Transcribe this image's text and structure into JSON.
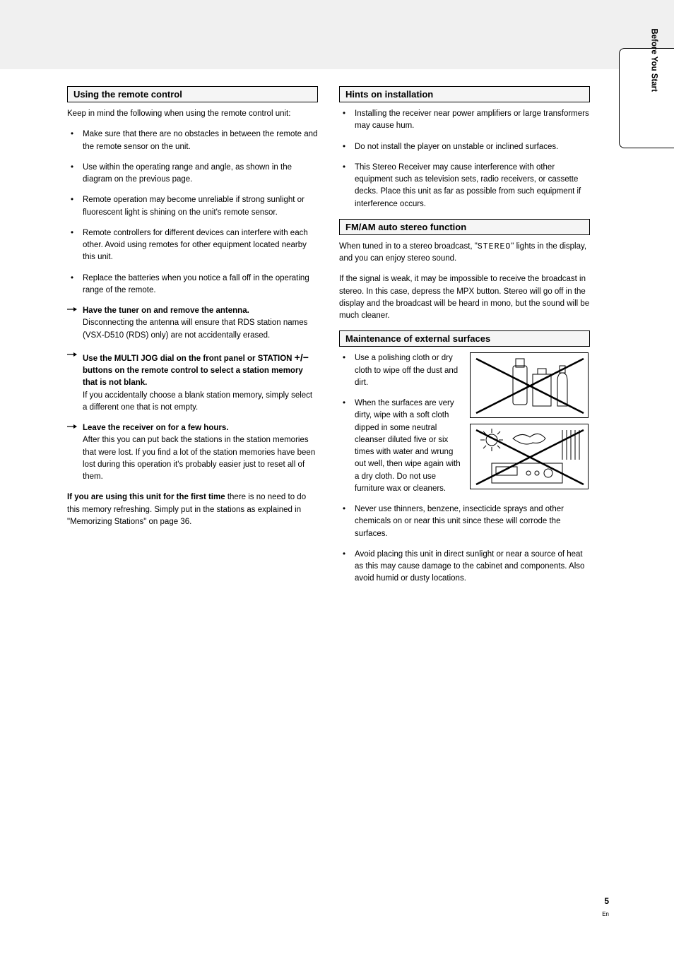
{
  "page_number": "5",
  "page_sub": "En",
  "side_tab": "Before You Start",
  "left": {
    "head": "Using the remote control",
    "p1": "Keep in mind the following when using the remote control unit:",
    "b1": "Make sure that there are no obstacles in between the remote and the remote sensor on the unit.",
    "b2": "Use within the operating range and angle, as shown in the diagram on the previous page.",
    "b3": "Remote operation may become unreliable if strong sunlight or fluorescent light is shining on the unit's remote sensor.",
    "b4": "Remote controllers for different devices can interfere with each other. Avoid using remotes for other equipment located nearby this unit.",
    "b5": "Replace the batteries when you notice a fall off in the operating range of the remote.",
    "item1_lead": "Have the tuner on and remove the antenna.",
    "item1_body": "Disconnecting the antenna will ensure that RDS station names (VSX-D510 (RDS) only) are not accidentally erased.",
    "item2_lead": "Use the MULTI JOG dial on the front",
    "item2_body_a": " panel or STATION ",
    "item2_body_b": " buttons on the remote control to select a station memory that is not blank.",
    "item2_body_c": "If you accidentally choose a blank station memory, simply select a different one that is not empty.",
    "item3_lead": "Leave the receiver on for a few hours.",
    "item3_body": "After this you can put back the stations in the station memories that were lost. If you find a lot of the station memories have been lost during this operation it's probably easier just to reset all of them.",
    "outro_lead": "If you are using this unit for the first time",
    "outro_body": " there is no need to do this memory refreshing. Simply put in the stations as explained in \"Memorizing Stations\" on page 36."
  },
  "right": {
    "head1": "Hints on installation",
    "b1": "Installing the receiver near power amplifiers or large transformers may cause hum.",
    "b2": "Do not install the player on unstable or inclined surfaces.",
    "b3": "This Stereo Receiver may cause interference with other equipment such as television sets, radio receivers, or cassette decks. Place this unit as far as possible from such equipment if interference occurs.",
    "head2": "FM/AM auto stereo function",
    "p2a": "When tuned in to a stereo broadcast, \"",
    "p2_stereo": "STEREO",
    "p2b": "\" lights in the display, and you can enjoy stereo sound.",
    "p2c": "If the signal is weak, it may be impossible to receive the broadcast in stereo. In this case, depress the MPX button. Stereo will go off in the display and the broadcast will be heard in mono, but the sound will be much cleaner.",
    "head3": "Maintenance of external surfaces",
    "m1": "Use a polishing cloth or dry cloth to wipe off the dust and dirt.",
    "m2": "When the surfaces are very dirty, wipe with a soft cloth dipped in some neutral cleanser diluted five or six times with water and wrung out well, then wipe again with a dry cloth. Do not use furniture wax or cleaners.",
    "m3": "Never use thinners, benzene, insecticide sprays and other chemicals on or near this unit since these will corrode the surfaces.",
    "m4": "Avoid placing this unit in direct sunlight or near a source of heat as this may cause damage to the cabinet and components. Also avoid humid or dusty locations."
  }
}
